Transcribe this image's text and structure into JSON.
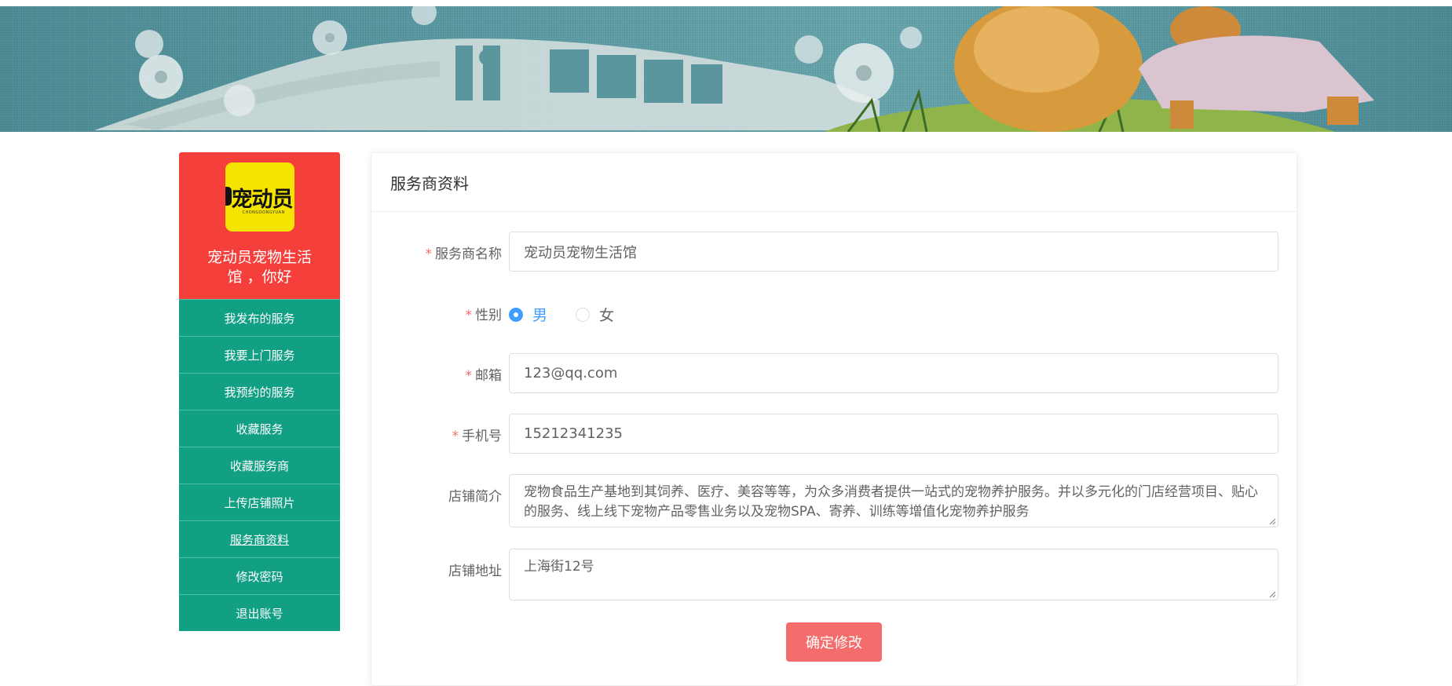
{
  "colors": {
    "banner": "#5e9da6",
    "profile_bg": "#f43f3b",
    "menu_bg": "#12a085",
    "required": "#f56c6c",
    "radio_checked": "#409eff",
    "submit_bg": "#f56c6c"
  },
  "sidebar": {
    "logo_text": "宠动员",
    "logo_sub": "CHONGDONGYUAN",
    "greeting": "宠动员宠物生活馆 ，你好",
    "items": [
      {
        "label": "我发布的服务"
      },
      {
        "label": "我要上门服务"
      },
      {
        "label": "我预约的服务"
      },
      {
        "label": "收藏服务"
      },
      {
        "label": "收藏服务商"
      },
      {
        "label": "上传店铺照片"
      },
      {
        "label": "服务商资料"
      },
      {
        "label": "修改密码"
      },
      {
        "label": "退出账号"
      }
    ]
  },
  "form": {
    "title": "服务商资料",
    "required_mark": "*",
    "name": {
      "label": "服务商名称",
      "value": "宠动员宠物生活馆"
    },
    "gender": {
      "label": "性别",
      "options": [
        "男",
        "女"
      ],
      "selected": "男"
    },
    "email": {
      "label": "邮箱",
      "value": "123@qq.com"
    },
    "phone": {
      "label": "手机号",
      "value": "15212341235"
    },
    "intro": {
      "label": "店铺简介",
      "value": "宠物食品生产基地到其饲养、医疗、美容等等，为众多消费者提供一站式的宠物养护服务。并以多元化的门店经营项目、贴心的服务、线上线下宠物产品零售业务以及宠物SPA、寄养、训练等增值化宠物养护服务"
    },
    "address": {
      "label": "店铺地址",
      "value": "上海街12号"
    },
    "submit_label": "确定修改"
  }
}
